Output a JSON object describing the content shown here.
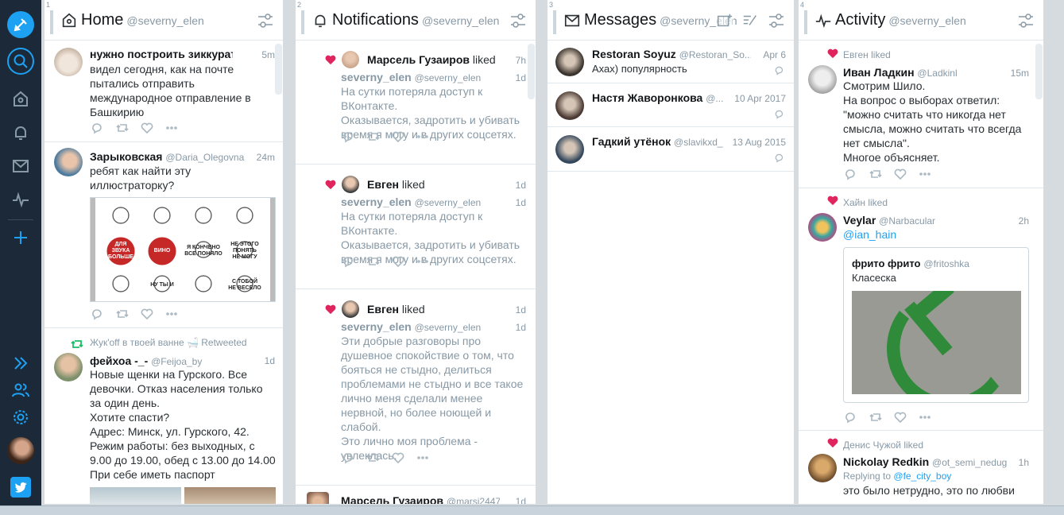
{
  "colors": {
    "nav_bg": "#1c2938",
    "accent": "#1da1f2",
    "like": "#e0245e",
    "retweet": "#17bf63"
  },
  "nav": {
    "icons": [
      "compose-icon",
      "search-icon",
      "home-icon",
      "notifications-icon",
      "messages-icon",
      "activity-icon",
      "add-column-icon",
      "expand-icon",
      "accounts-icon",
      "settings-icon",
      "avatar",
      "twitter-logo-icon"
    ]
  },
  "columns": [
    {
      "num": "1",
      "title": "Home",
      "handle": "@severny_elen"
    },
    {
      "num": "2",
      "title": "Notifications",
      "handle": "@severny_elen"
    },
    {
      "num": "3",
      "title": "Messages",
      "handle": "@severny_elen"
    },
    {
      "num": "4",
      "title": "Activity",
      "handle": "@severny_elen"
    }
  ],
  "home": [
    {
      "name": "нужно построить зиккурат ...",
      "handle": "",
      "time": "5m",
      "text": "видел сегодня, как на почте\nпытались отправить\nмеждународное отправление в\nБашкирию"
    },
    {
      "name": "Зарыковская",
      "handle": "@Daria_Olegovna",
      "time": "24m",
      "text": "ребят как найти эту\nиллюстраторку?",
      "stickers": [
        "",
        "",
        "",
        "",
        "ДЛЯ\nЗВУКА\nБОЛЬШЕ",
        "ВИНО",
        "Я КОНЧЕНО\nВСЕ ПОНЯЛО",
        "НЕ ЭТОГО\nПОНЯТЬ\nНЕ МОГУ",
        "",
        "НУ ТЫ И\n",
        "",
        "С ТОБОЙ\nНЕ ВЕСЕЛО"
      ]
    },
    {
      "context": "Жук'off в твоей ванне 🛁 Retweeted",
      "name": "фейхоа -_-",
      "handle": "@Feijoa_by",
      "time": "1d",
      "text": "Новые щенки на Гурского. Все\nдевочки. Отказ населения только\nза один день.\nХотите спасти?\nАдрес: Минск, ул. Гурского, 42.\nРежим работы: без выходных, с\n9.00 до 19.00, обед с 13.00 до 14.00\nПри себе иметь паспорт"
    }
  ],
  "notifications": [
    {
      "liker": "Марсель Гузаиров",
      "action": "liked",
      "time": "7h",
      "author": "severny_elen",
      "author_handle": "@severny_elen",
      "time2": "1d",
      "text": "На сутки потеряла доступ к\nВКонтакте.\nОказывается, задротить и убивать\nвремя я могу и в других соцсетях."
    },
    {
      "liker": "Евген",
      "action": "liked",
      "time": "1d",
      "author": "severny_elen",
      "author_handle": "@severny_elen",
      "time2": "1d",
      "text": "На сутки потеряла доступ к\nВКонтакте.\nОказывается, задротить и убивать\nвремя я могу и в других соцсетях."
    },
    {
      "liker": "Евген",
      "action": "liked",
      "time": "1d",
      "author": "severny_elen",
      "author_handle": "@severny_elen",
      "time2": "1d",
      "text": "Эти добрые разговоры про\nдушевное спокойствие о том, что\nбояться не стыдно, делиться\nпроблемами не стыдно и все такое\nлично меня сделали менее\nнервной, но более ноющей и\nслабой.\nЭто лично моя проблема -\nувлеклась."
    },
    {
      "name": "Марсель Гузаиров",
      "handle": "@marsi2447...",
      "time": "1d"
    }
  ],
  "messages": [
    {
      "name": "Restoran Soyuz",
      "handle": "@Restoran_So...",
      "time": "Apr 6",
      "text": "Ахах) популярность"
    },
    {
      "name": "Настя Жаворонкова",
      "handle": "@...",
      "time": "10 Apr 2017",
      "text": ""
    },
    {
      "name": "Гадкий утёнок",
      "handle": "@slavikxd_",
      "time": "13 Aug 2015",
      "text": ""
    }
  ],
  "activity": [
    {
      "context": "Евген liked",
      "name": "Иван Ладкин",
      "handle": "@Ladkinl",
      "time": "15m",
      "text": "Смотрим Шило.\nНа вопрос о выборах ответил:\n\"можно считать что никогда нет\nсмысла, можно считать что всегда\nнет смысла\".\nМногое объясняет."
    },
    {
      "context": "Хайн liked",
      "name": "Veylar",
      "handle": "@Narbacular",
      "time": "2h",
      "mention": "@ian_hain",
      "quote_name": "фрито фрито",
      "quote_handle": "@fritoshka",
      "quote_text": "Класеска"
    },
    {
      "context": "Денис Чужой liked",
      "name": "Nickolay Redkin",
      "handle": "@ot_semi_nedug",
      "time": "1h",
      "reply_prefix": "Replying to",
      "reply_to": "@fe_city_boy",
      "text": "это было нетрудно, это по любви"
    }
  ]
}
